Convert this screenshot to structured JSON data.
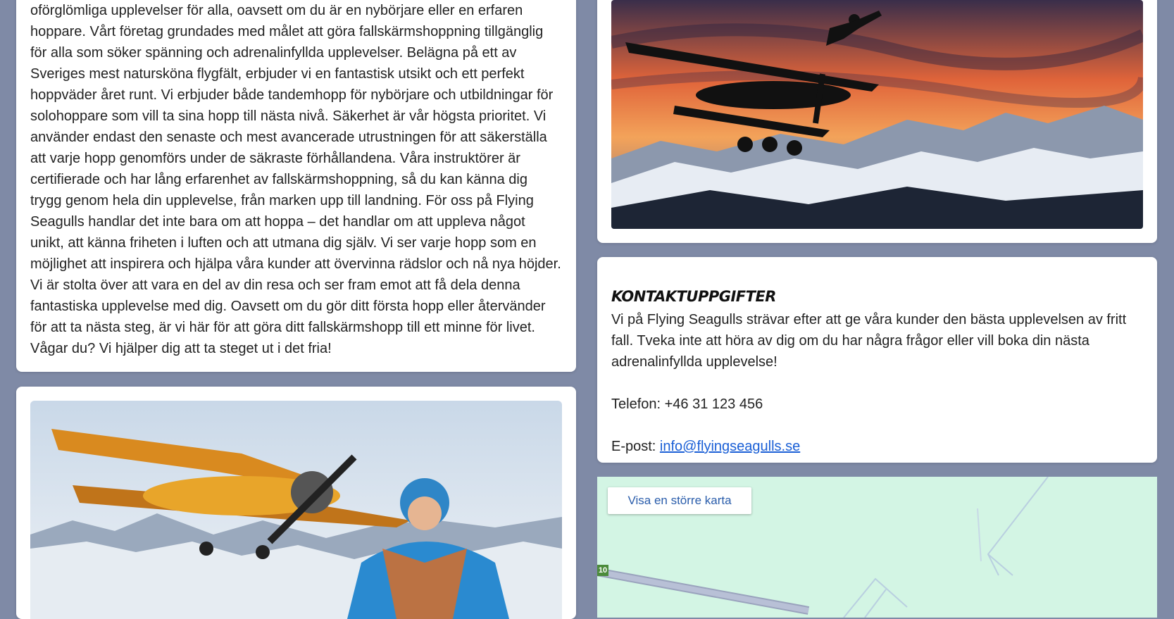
{
  "about": {
    "text": "oförglömliga upplevelser för alla, oavsett om du är en nybörjare eller en erfaren hoppare. Vårt företag grundades med målet att göra fallskärmshoppning tillgänglig för alla som söker spänning och adrenalinfyllda upplevelser. Belägna på ett av Sveriges mest naturskönа flygfält, erbjuder vi en fantastisk utsikt och ett perfekt hoppväder året runt. Vi erbjuder både tandemhopp för nybörjare och utbildningar för solohoppare som vill ta sina hopp till nästa nivå. Säkerhet är vår högsta prioritet. Vi använder endast den senaste och mest avancerade utrustningen för att säkerställa att varje hopp genomförs under de säkraste förhållandena. Våra instruktörer är certifierade och har lång erfarenhet av fallskärmshoppning, så du kan känna dig trygg genom hela din upplevelse, från marken upp till landning. För oss på Flying Seagulls handlar det inte bara om att hoppa – det handlar om att uppleva något unikt, att känna friheten i luften och att utmana dig själv. Vi ser varje hopp som en möjlighet att inspirera och hjälpa våra kunder att övervinna rädslor och nå nya höjder. Vi är stolta över att vara en del av din resa och ser fram emot att få dela denna fantastiska upplevelse med dig. Oavsett om du gör ditt första hopp eller återvänder för att ta nästa steg, är vi här för att göra ditt fallskärmshopp till ett minne för livet. Vågar du? Vi hjälper dig att ta steget ut i det fria!"
  },
  "contact": {
    "title": "Kontaktuppgifter",
    "intro": "Vi på Flying Seagulls strävar efter att ge våra kunder den bästa upplevelsen av fritt fall. Tveka inte att höra av dig om du har några frågor eller vill boka din nästa adrenalinfyllda upplevelse!",
    "phone": "Telefon: +46 31 123 456",
    "email_label": "E-post: ",
    "email": "info@flyingseagulls.se"
  },
  "map": {
    "button_label": "Visa en större karta",
    "road_number": "10"
  },
  "colors": {
    "page_bg": "#7f8aa6",
    "link": "#1a5fd6",
    "map_bg": "#d3f5e4"
  }
}
